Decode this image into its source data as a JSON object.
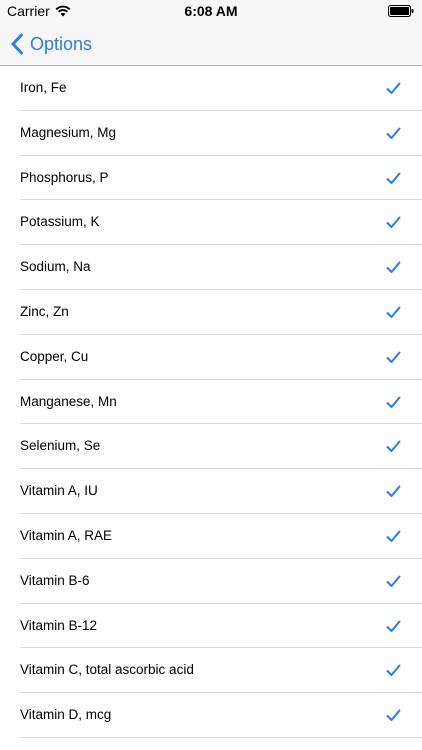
{
  "status_bar": {
    "carrier": "Carrier",
    "time": "6:08 AM",
    "wifi_icon": "wifi-icon",
    "battery_icon": "battery-full-icon"
  },
  "nav": {
    "back_label": "Options",
    "back_icon": "chevron-left-icon"
  },
  "colors": {
    "accent": "#2a7fe2",
    "separator": "#dcdcdf",
    "bar_background": "#f7f7f8"
  },
  "items": [
    {
      "label": "Iron, Fe",
      "checked": true
    },
    {
      "label": "Magnesium, Mg",
      "checked": true
    },
    {
      "label": "Phosphorus, P",
      "checked": true
    },
    {
      "label": "Potassium, K",
      "checked": true
    },
    {
      "label": "Sodium, Na",
      "checked": true
    },
    {
      "label": "Zinc, Zn",
      "checked": true
    },
    {
      "label": "Copper, Cu",
      "checked": true
    },
    {
      "label": "Manganese, Mn",
      "checked": true
    },
    {
      "label": "Selenium, Se",
      "checked": true
    },
    {
      "label": "Vitamin A, IU",
      "checked": true
    },
    {
      "label": "Vitamin A, RAE",
      "checked": true
    },
    {
      "label": "Vitamin B-6",
      "checked": true
    },
    {
      "label": "Vitamin B-12",
      "checked": true
    },
    {
      "label": "Vitamin C, total ascorbic acid",
      "checked": true
    },
    {
      "label": "Vitamin D, mcg",
      "checked": true
    }
  ]
}
